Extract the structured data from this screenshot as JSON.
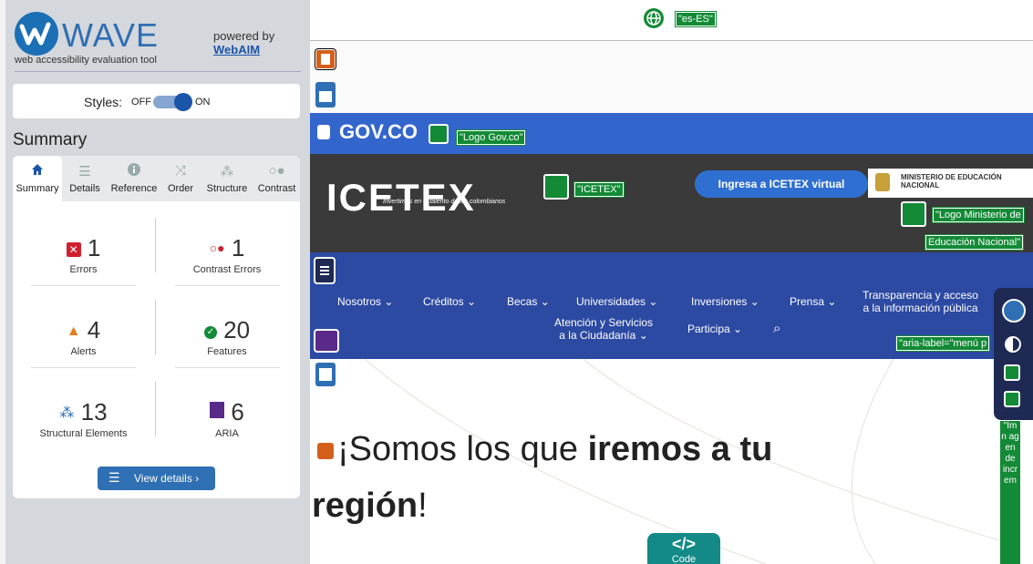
{
  "sidebar": {
    "logo_text": "WAVE",
    "tagline": "web accessibility evaluation tool",
    "powered_by": "powered by",
    "webaim_link": "WebAIM",
    "styles_label": "Styles:",
    "styles_off": "OFF",
    "styles_on": "ON",
    "summary_heading": "Summary",
    "tabs": [
      {
        "label": "Summary",
        "icon": "home-icon"
      },
      {
        "label": "Details",
        "icon": "list-icon"
      },
      {
        "label": "Reference",
        "icon": "info-icon"
      },
      {
        "label": "Order",
        "icon": "order-icon"
      },
      {
        "label": "Structure",
        "icon": "structure-icon"
      },
      {
        "label": "Contrast",
        "icon": "contrast-icon"
      }
    ],
    "stats": [
      {
        "count": "1",
        "label": "Errors",
        "icon": "error-icon",
        "color": "#d0202e"
      },
      {
        "count": "1",
        "label": "Contrast Errors",
        "icon": "contrast-error-icon",
        "color": "#d0202e"
      },
      {
        "count": "4",
        "label": "Alerts",
        "icon": "alert-icon",
        "color": "#e37f1c"
      },
      {
        "count": "20",
        "label": "Features",
        "icon": "feature-icon",
        "color": "#138a36"
      },
      {
        "count": "13",
        "label": "Structural Elements",
        "icon": "structure-icon",
        "color": "#2f6fb3"
      },
      {
        "count": "6",
        "label": "ARIA",
        "icon": "aria-icon",
        "color": "#5a2a8a"
      }
    ],
    "view_details": "View details ›"
  },
  "page": {
    "lang_tag": "\"es-ES\"",
    "gov_text": "GOV.CO",
    "gov_alt": "\"Logo Gov.co\"",
    "icetex_logo": "ICETEX",
    "icetex_sub": "Invertimos en el talento de los colombianos",
    "icetex_alt": "\"ICETEX\"",
    "ingresa": "Ingresa a ICETEX virtual",
    "ministerio": "MINISTERIO DE EDUCACIÓN NACIONAL",
    "ministerio_alt_1": "\"Logo Ministerio de",
    "ministerio_alt_2": "Educación Nacional\"",
    "nav": [
      "Nosotros",
      "Créditos",
      "Becas",
      "Universidades",
      "Inversiones",
      "Prensa"
    ],
    "nav_transp_1": "Transparencia y acceso",
    "nav_transp_2": "a la información pública",
    "nav_atencion_1": "Atención y Servicios",
    "nav_atencion_2": "a la Ciudadanía",
    "nav_participa": "Participa",
    "aria_label": "\"aria-label=\"menú p",
    "hero_pre": "¡Somos los que ",
    "hero_bold": "iremos a tu",
    "hero_bold2": "región",
    "hero_end": "!",
    "code_label": "Code",
    "vertical_strip": "\"Im n ag en de incr em"
  },
  "colors": {
    "wave_blue": "#2f6fb3",
    "feature_green": "#138a36",
    "gov_blue": "#3366cc",
    "nav_blue": "#2d4aa3"
  }
}
